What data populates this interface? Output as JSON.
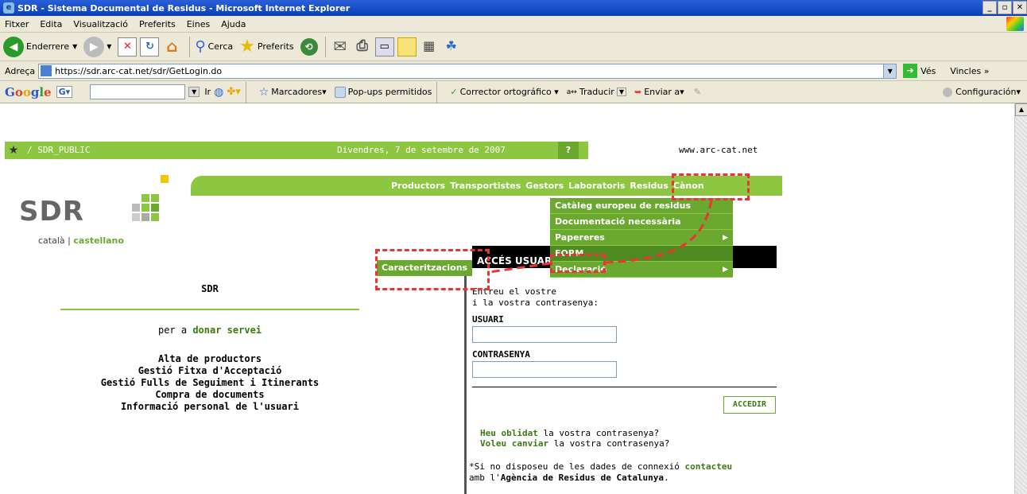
{
  "window": {
    "title": "SDR - Sistema Documental de Residus - Microsoft Internet Explorer",
    "minimize": "_",
    "maximize": "▫",
    "close": "✕"
  },
  "menubar": [
    "Fitxer",
    "Edita",
    "Visualització",
    "Preferits",
    "Eines",
    "Ajuda"
  ],
  "toolbar": {
    "back": "Enderrere",
    "search": "Cerca",
    "favorites": "Preferits"
  },
  "address": {
    "label": "Adreça",
    "url": "https://sdr.arc-cat.net/sdr/GetLogin.do",
    "go": "Vés",
    "links": "Vincles »"
  },
  "googlebar": {
    "brand": "Google",
    "bookmarks": "Marcadores▾",
    "popups": "Pop-ups permitidos",
    "spell": "Corrector ortográfico ▾",
    "translate": "Traducir",
    "send": "Enviar a▾",
    "config": "Configuración▾"
  },
  "strip": {
    "path": "/ SDR_PUBLIC",
    "date": "Divendres, 7 de setembre de 2007",
    "help": "?",
    "website": "www.arc-cat.net"
  },
  "logo": "SDR",
  "lang": {
    "catala": "català",
    "sep": " | ",
    "castellano": "castellano"
  },
  "nav": [
    "Productors",
    "Transportistes",
    "Gestors",
    "Laboratoris",
    "Residus",
    "Cànon"
  ],
  "dropdown": [
    {
      "label": "Catàleg europeu de residus",
      "arrow": ""
    },
    {
      "label": "Documentació necessària",
      "arrow": ""
    },
    {
      "label": "Papereres",
      "arrow": "▶"
    },
    {
      "label": "FORM",
      "arrow": ""
    },
    {
      "label": "Declaració",
      "arrow": "▶"
    }
  ],
  "submenu": "Caracteritzacions",
  "login": {
    "header": "ACCÉS USUARI",
    "intro1": "Entreu el vostre",
    "intro2": "i la vostra contrasenya:",
    "user_label": "USUARI",
    "pass_label": "CONTRASENYA",
    "submit": "ACCEDIR",
    "forgot_link": "Heu oblidat",
    "forgot_rest": " la vostra contrasenya?",
    "change_link": "Voleu canviar",
    "change_rest": " la vostra contrasenya?",
    "notice_pre": "*Si no disposeu de les dades de connexió ",
    "notice_link": "contacteu",
    "notice_mid": "amb l'",
    "notice_org": "Agència de Residus de Catalunya",
    "notice_end": "."
  },
  "left": {
    "title": "SDR",
    "serve_pre": "per a ",
    "serve_link": "donar servei",
    "links": [
      "Alta de productors",
      "Gestió Fitxa d'Acceptació",
      "Gestió Fulls de Seguiment i Itinerants",
      "Compra de documents",
      "Informació personal de l'usuari"
    ]
  },
  "colors": {
    "green": "#8dc641",
    "darkgreen": "#6aa830",
    "highlight": "#e33333"
  }
}
